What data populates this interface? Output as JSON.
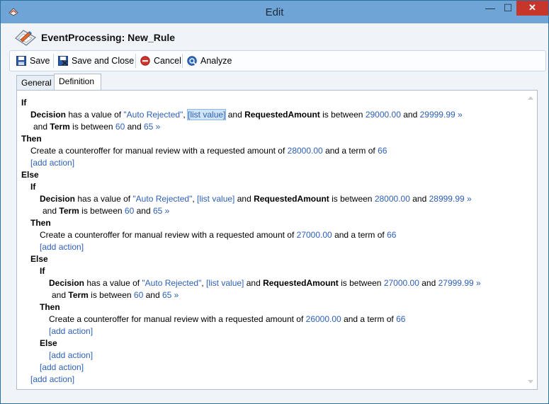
{
  "window": {
    "title": "Edit",
    "minimize": "—",
    "maximize": "☐",
    "close": "✕"
  },
  "header": {
    "title": "EventProcessing: New_Rule"
  },
  "toolbar": {
    "save": "Save",
    "save_close": "Save and Close",
    "cancel": "Cancel",
    "analyze": "Analyze"
  },
  "tabs": {
    "general": "General",
    "definition": "Definition"
  },
  "rule": {
    "kw_if": "If",
    "kw_then": "Then",
    "kw_else": "Else",
    "decision": "Decision",
    "has_value": "has a value of",
    "auto_rejected": "\"Auto Rejected\"",
    "comma": ",",
    "list_value": "[list value]",
    "and": "and",
    "requested_amount": "RequestedAmount",
    "is_between": "is between",
    "term": "Term",
    "arrow": "»",
    "action_text": "Create a counteroffer for manual review with a requested amount of",
    "and_a_term_of": "and a term of",
    "add_action": "[add action]",
    "term_min": "60",
    "term_max": "65",
    "levels": [
      {
        "amount_min": "29000.00",
        "amount_max": "29999.99",
        "offer": "28000.00",
        "offer_term": "66"
      },
      {
        "amount_min": "28000.00",
        "amount_max": "28999.99",
        "offer": "27000.00",
        "offer_term": "66"
      },
      {
        "amount_min": "27000.00",
        "amount_max": "27999.99",
        "offer": "26000.00",
        "offer_term": "66"
      }
    ]
  }
}
